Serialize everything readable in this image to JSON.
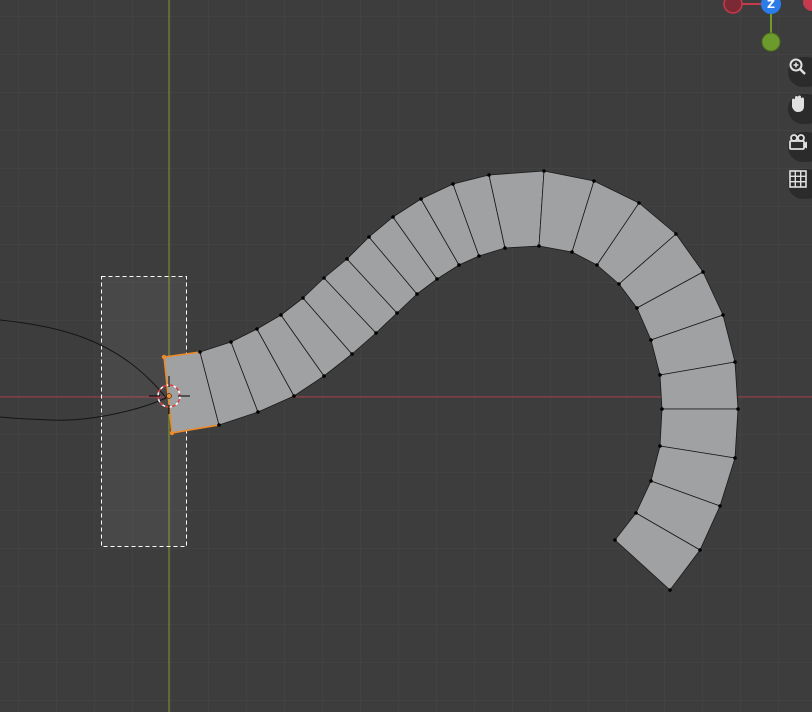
{
  "viewport": {
    "background": "#3d3d3d",
    "grid_minor_color": "#474747",
    "x_axis_color": "#a33a4a",
    "y_axis_color": "#7d9a2c"
  },
  "mesh": {
    "face_color": "#a0a1a2",
    "edge_color": "#1a1a1a",
    "selected_color": "#f08a24"
  },
  "gizmo": {
    "z_label": "Z",
    "z_color": "#2b7ce8",
    "y_color": "#6d9a2c",
    "x_color": "#c53a4c"
  },
  "nav": {
    "zoom_icon": "magnifier-plus-icon",
    "pan_icon": "hand-icon",
    "camera_icon": "camera-icon",
    "grid_icon": "grid-icon"
  }
}
